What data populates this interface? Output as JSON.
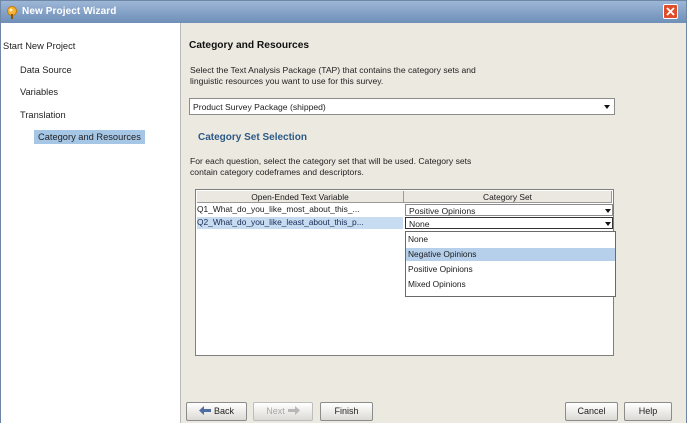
{
  "window": {
    "title": "New Project Wizard"
  },
  "nav": {
    "root": "Start New Project",
    "items": [
      "Data Source",
      "Variables",
      "Translation",
      "Category and Resources"
    ]
  },
  "content": {
    "heading": "Category and Resources",
    "desc1_line1": "Select the Text Analysis Package (TAP) that contains the category sets and",
    "desc1_line2": "linguistic resources you want to use for this survey.",
    "tap_selected": "Product Survey Package (shipped)",
    "subheading": "Category Set Selection",
    "desc2_line1": "For each question, select the category set that will be used. Category sets",
    "desc2_line2": "contain category codeframes and descriptors."
  },
  "table": {
    "headers": [
      "Open-Ended Text Variable",
      "Category Set"
    ],
    "rows": [
      {
        "variable": "Q1_What_do_you_like_most_about_this_...",
        "category": "Positive Opinions"
      },
      {
        "variable": "Q2_What_do_you_like_least_about_this_p...",
        "category": "None"
      }
    ],
    "dropdown_options": [
      "None",
      "Negative Opinions",
      "Positive Opinions",
      "Mixed Opinions"
    ],
    "highlighted_option": "Negative Opinions"
  },
  "buttons": {
    "back": "Back",
    "next": "Next",
    "finish": "Finish",
    "cancel": "Cancel",
    "help": "Help"
  },
  "colors": {
    "titlebar": "#7d9bc4",
    "close": "#e04d2b",
    "nav_selected": "#a6c6e6",
    "subheading": "#2c5a87"
  }
}
